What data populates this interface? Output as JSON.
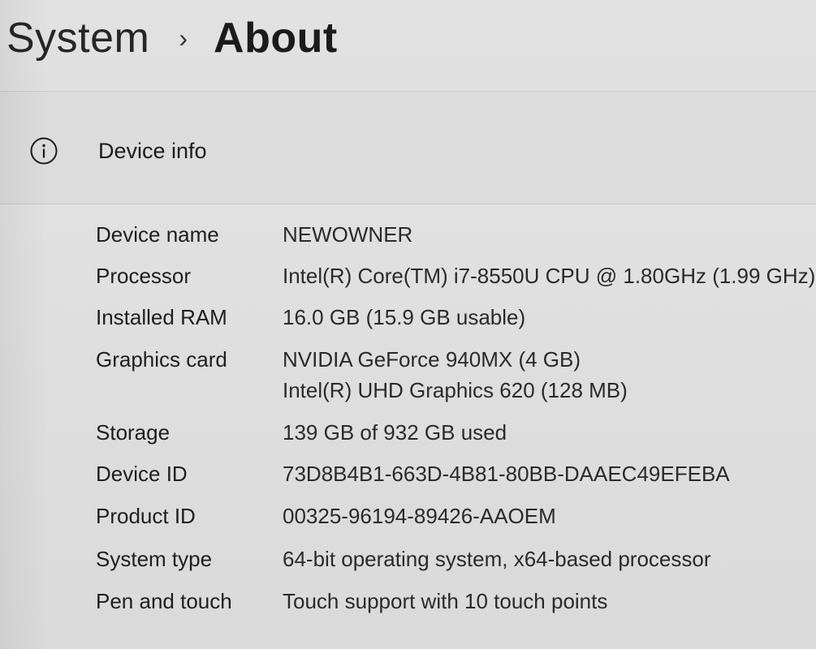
{
  "breadcrumb": {
    "parent": "System",
    "separator": "›",
    "current": "About"
  },
  "device_info": {
    "icon": "info-circle-icon",
    "title": "Device info",
    "specs": [
      {
        "label": "Device name",
        "value": "NEWOWNER"
      },
      {
        "label": "Processor",
        "value": "Intel(R) Core(TM) i7-8550U CPU @ 1.80GHz (1.99 GHz)"
      },
      {
        "label": "Installed RAM",
        "value": "16.0 GB (15.9 GB usable)"
      },
      {
        "label": "Graphics card",
        "value": "NVIDIA GeForce 940MX (4 GB)",
        "value2": "Intel(R) UHD Graphics 620 (128 MB)"
      },
      {
        "label": "Storage",
        "value": "139 GB of 932 GB used"
      },
      {
        "label": "Device ID",
        "value": "73D8B4B1-663D-4B81-80BB-DAAEC49EFEBA"
      },
      {
        "label": "Product ID",
        "value": "00325-96194-89426-AAOEM"
      },
      {
        "label": "System type",
        "value": "64-bit operating system, x64-based processor"
      },
      {
        "label": "Pen and touch",
        "value": "Touch support with 10 touch points"
      }
    ]
  }
}
